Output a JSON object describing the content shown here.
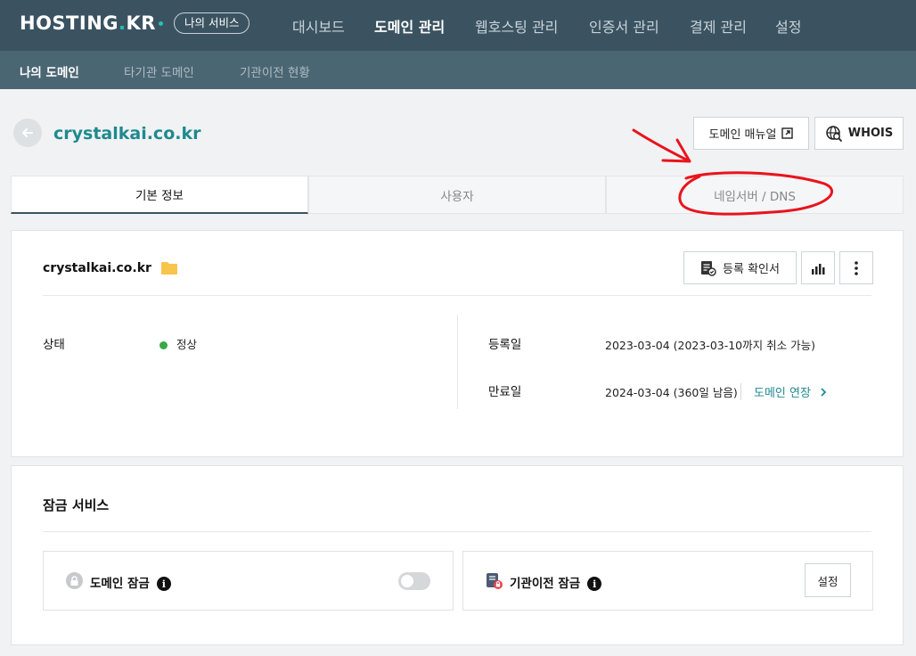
{
  "header": {
    "logo_main": "HOSTING",
    "logo_dot": ".",
    "logo_suffix": "KR",
    "my_service": "나의 서비스",
    "nav": [
      "대시보드",
      "도메인 관리",
      "웹호스팅 관리",
      "인증서 관리",
      "결제 관리",
      "설정"
    ],
    "active_nav": "도메인 관리"
  },
  "subnav": {
    "items": [
      "나의 도메인",
      "타기관 도메인",
      "기관이전 현황"
    ],
    "active": "나의 도메인"
  },
  "page": {
    "domain": "crystalkai.co.kr",
    "manual_button": "도메인 매뉴얼",
    "whois_button": "WHOIS"
  },
  "tabs": [
    "기본 정보",
    "사용자",
    "네임서버 / DNS"
  ],
  "info": {
    "domain": "crystalkai.co.kr",
    "cert_button": "등록 확인서",
    "status_label": "상태",
    "status_value": "정상",
    "registered_label": "등록일",
    "registered_value": "2023-03-04 (2023-03-10까지 취소 가능)",
    "expires_label": "만료일",
    "expires_value": "2024-03-04 (360일 남음)",
    "extend_link": "도메인 연장"
  },
  "lock": {
    "title": "잠금 서비스",
    "domain_lock_label": "도메인 잠금",
    "domain_lock_on": false,
    "transfer_lock_label": "기관이전 잠금",
    "setting_button": "설정"
  },
  "colors": {
    "topbar": "#3b5361",
    "subbar": "#4b6673",
    "accent": "#1e8a8f",
    "status_ok": "#39a845",
    "annotation": "#e8141c"
  }
}
